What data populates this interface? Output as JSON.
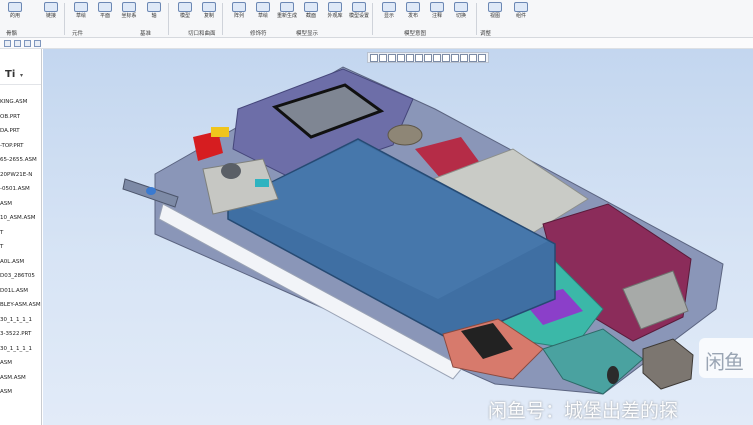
{
  "ribbon": {
    "buttons": [
      {
        "label": "的用"
      },
      {
        "label": "链接"
      },
      {
        "label": "草绘"
      },
      {
        "label": "平面"
      },
      {
        "label": "坐标系"
      },
      {
        "label": "轴"
      },
      {
        "label": "模型"
      },
      {
        "label": "复制"
      },
      {
        "label": "阵列"
      },
      {
        "label": "草绘"
      },
      {
        "label": "重新生成"
      },
      {
        "label": "截面"
      },
      {
        "label": "外观库"
      },
      {
        "label": "模型设置"
      },
      {
        "label": "显示"
      },
      {
        "label": "发布"
      },
      {
        "label": "注释"
      },
      {
        "label": "切换"
      },
      {
        "label": "视图"
      },
      {
        "label": "组件"
      }
    ],
    "groups": [
      "骨骼",
      "元件",
      "基准",
      "切口和曲面",
      "修饰符",
      "模型显示",
      "模型意图",
      "调整"
    ]
  },
  "tree": {
    "title": "Ti",
    "items": [
      "KING.ASM",
      "OB.PRT",
      "DA.PRT",
      "-TOP.PRT",
      "65-2655.ASM",
      "20PW21E-N",
      "-0501.ASM",
      "ASM",
      "10_ASM.ASM",
      "T",
      "T",
      "A0L.ASM",
      "D03_286T05",
      "D01L.ASM",
      "BLEY-ASM.ASM",
      "30_1_1_1_1",
      "3-3522.PRT",
      "30_1_1_1_1",
      "ASM",
      "ASM.ASM",
      "ASM"
    ]
  },
  "canvas": {
    "watermark_badge": "闲鱼",
    "watermark_text": "闲鱼号：城堡出差的探"
  },
  "colors": {
    "background": "#c8d9f0",
    "battery": "#3f6fa3",
    "board_magenta": "#8b2c5a",
    "board_teal": "#3bb8a8",
    "red_part": "#d61d20"
  }
}
